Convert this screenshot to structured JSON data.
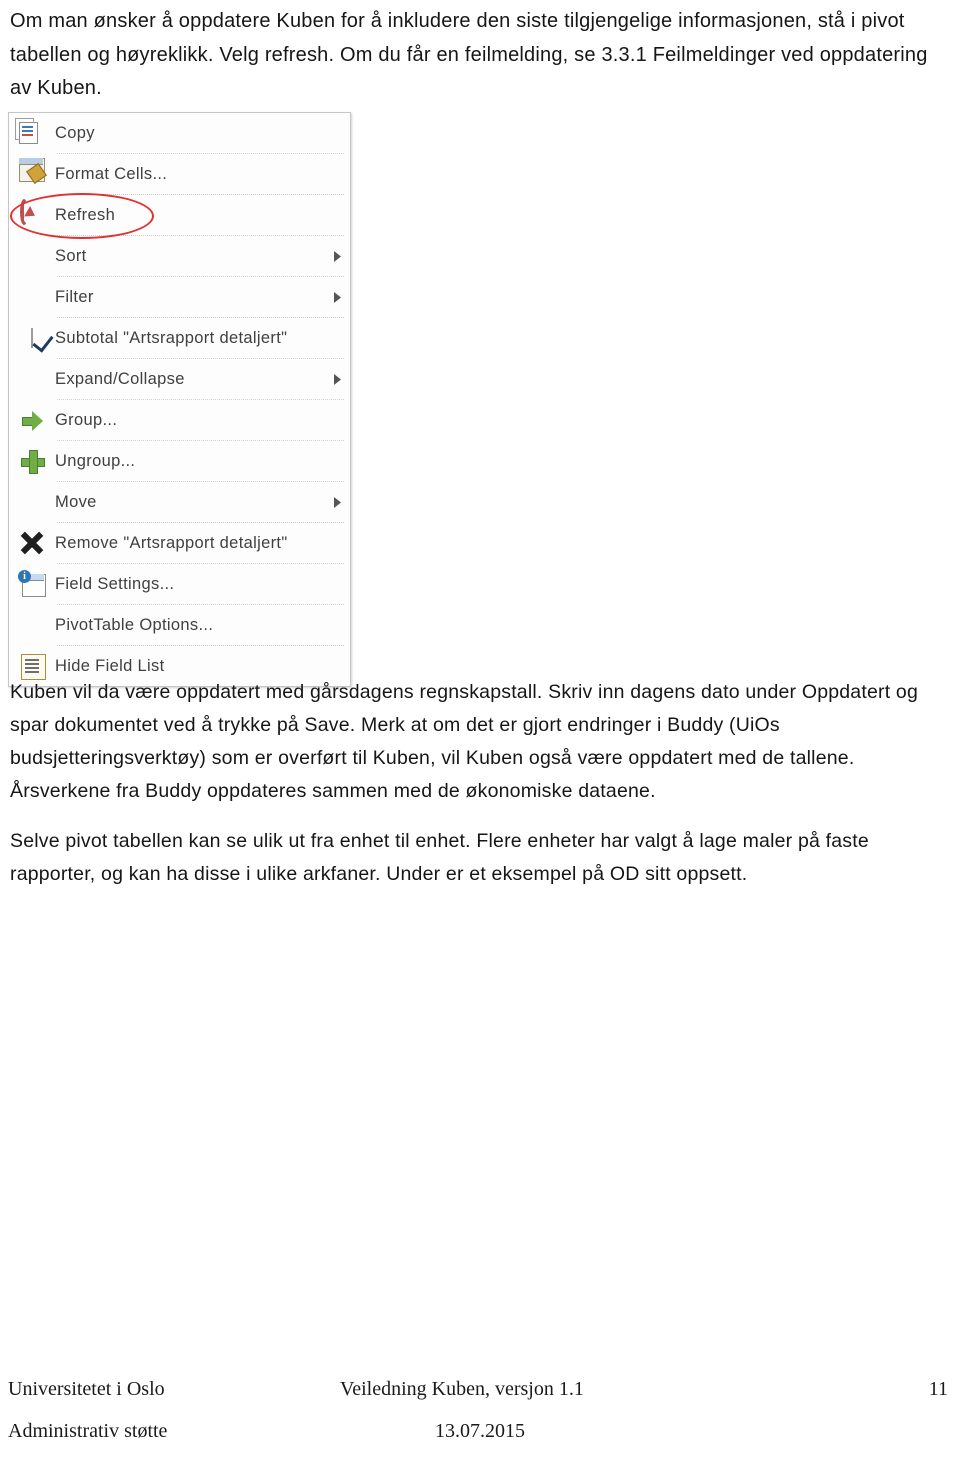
{
  "document": {
    "top_paragraph": "Om man ønsker å oppdatere Kuben for å inkludere den siste tilgjengelige informasjonen, stå i pivot tabellen og høyreklikk. Velg refresh. Om du får en feilmelding, se 3.3.1 Feilmeldinger ved oppdatering av Kuben.",
    "mid_paragraph": "Kuben vil da være oppdatert med gårsdagens regnskapstall. Skriv inn dagens dato under Oppdatert og spar dokumentet ved å trykke på Save. Merk at om det er gjort endringer i Buddy (UiOs budsjetteringsverktøy) som er overført til Kuben, vil Kuben også være oppdatert med de tallene. Årsverkene fra Buddy oppdateres sammen med de økonomiske dataene.",
    "mid_paragraph2": "Selve pivot tabellen kan se ulik ut fra enhet til enhet. Flere enheter har valgt å lage maler på faste rapporter, og kan ha disse i ulike arkfaner. Under er et eksempel på OD sitt oppsett."
  },
  "context_menu": {
    "items": [
      {
        "label": "Copy",
        "icon": "copy-icon",
        "submenu": false
      },
      {
        "label": "Format Cells...",
        "icon": "format-cells-icon",
        "submenu": false
      },
      {
        "label": "Refresh",
        "icon": "refresh-icon",
        "submenu": false
      },
      {
        "label": "Sort",
        "icon": "none",
        "submenu": true
      },
      {
        "label": "Filter",
        "icon": "none",
        "submenu": true
      },
      {
        "label": "Subtotal \"Artsrapport detaljert\"",
        "icon": "checkmark-icon",
        "submenu": false
      },
      {
        "label": "Expand/Collapse",
        "icon": "none",
        "submenu": true
      },
      {
        "label": "Group...",
        "icon": "group-arrow-icon",
        "submenu": false
      },
      {
        "label": "Ungroup...",
        "icon": "ungroup-plus-icon",
        "submenu": false
      },
      {
        "label": "Move",
        "icon": "none",
        "submenu": true
      },
      {
        "label": "Remove \"Artsrapport detaljert\"",
        "icon": "remove-x-icon",
        "submenu": false
      },
      {
        "label": "Field Settings...",
        "icon": "field-settings-icon",
        "submenu": false
      },
      {
        "label": "PivotTable Options...",
        "icon": "none",
        "submenu": false
      },
      {
        "label": "Hide Field List",
        "icon": "hide-field-list-icon",
        "submenu": false
      }
    ],
    "annotation_color": "#e03030",
    "annotated_item": "Refresh"
  },
  "footer": {
    "left_line1": "Universitetet i Oslo",
    "center_line1": "Veiledning Kuben, versjon 1.1",
    "page_number": "11",
    "left_line2": "Administrativ støtte",
    "center_line2": "13.07.2015"
  }
}
